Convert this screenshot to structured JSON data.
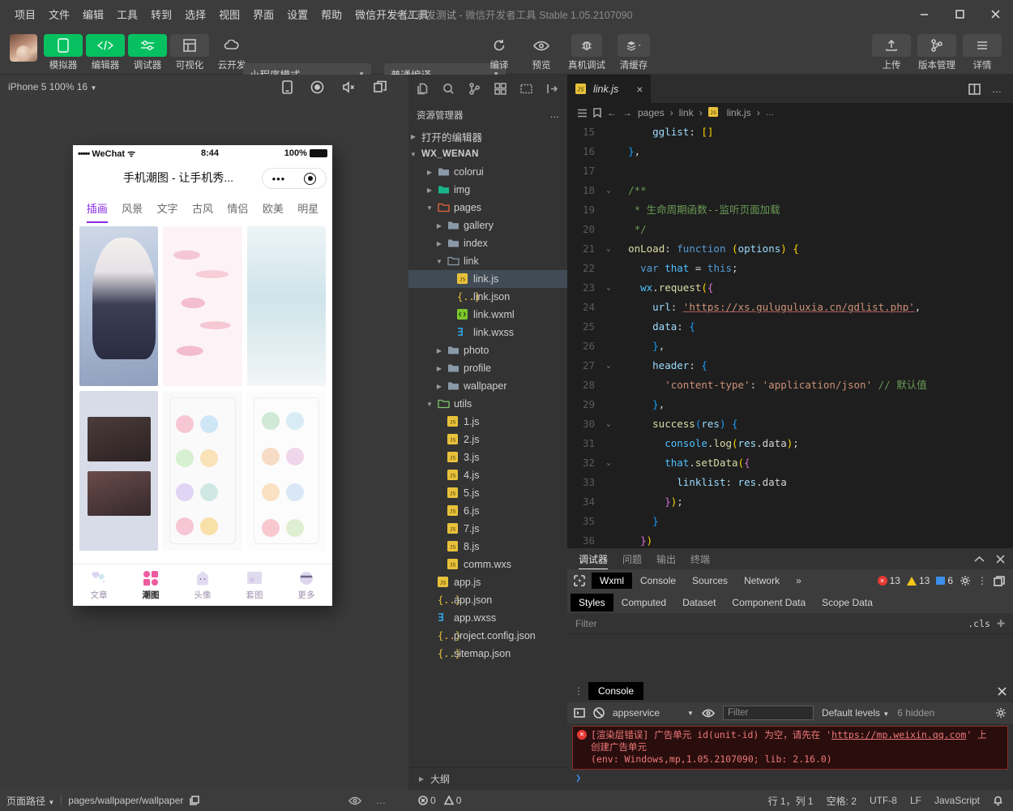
{
  "titlebar": {
    "menus": [
      "项目",
      "文件",
      "编辑",
      "工具",
      "转到",
      "选择",
      "视图",
      "界面",
      "设置",
      "帮助",
      "微信开发者工具"
    ],
    "project_name": "个人开发测试",
    "app_name": "微信开发者工具",
    "version": "Stable 1.05.2107090",
    "minimize": "minimize-icon",
    "maximize": "maximize-icon",
    "close": "close-icon"
  },
  "toolbar": {
    "left_buttons": [
      {
        "label": "模拟器",
        "icon": "phone-icon",
        "state": "green"
      },
      {
        "label": "编辑器",
        "icon": "code-icon",
        "state": "green"
      },
      {
        "label": "调试器",
        "icon": "debug-icon",
        "state": "green"
      },
      {
        "label": "可视化",
        "icon": "layout-icon",
        "state": "grey"
      },
      {
        "label": "云开发",
        "icon": "cloud-icon",
        "state": "plain"
      }
    ],
    "mode_select": "小程序模式",
    "compile_select": "普通编译",
    "center_buttons": [
      {
        "label": "编译",
        "icon": "refresh-icon"
      },
      {
        "label": "预览",
        "icon": "eye-icon"
      },
      {
        "label": "真机调试",
        "icon": "bug-icon"
      },
      {
        "label": "清缓存",
        "icon": "layers-icon"
      }
    ],
    "right_buttons": [
      {
        "label": "上传",
        "icon": "upload-icon"
      },
      {
        "label": "版本管理",
        "icon": "branch-icon"
      },
      {
        "label": "详情",
        "icon": "menu-icon"
      }
    ]
  },
  "simulator": {
    "device_label": "iPhone 5 100% 16",
    "toolbar_icons": [
      "device-rotate-icon",
      "record-icon",
      "mute-icon",
      "multiscreen-icon"
    ],
    "status_bar": {
      "carrier": "WeChat",
      "signal": "•••••",
      "time": "8:44",
      "battery": "100%"
    },
    "nav_title": "手机潮图 - 让手机秀...",
    "categories": [
      {
        "label": "插画",
        "active": true
      },
      {
        "label": "风景",
        "active": false
      },
      {
        "label": "文字",
        "active": false
      },
      {
        "label": "古风",
        "active": false
      },
      {
        "label": "情侣",
        "active": false
      },
      {
        "label": "欧美",
        "active": false
      },
      {
        "label": "明星",
        "active": false
      }
    ],
    "tabbar": [
      {
        "label": "文章",
        "icon": "hearts-icon",
        "active": false
      },
      {
        "label": "潮图",
        "icon": "grid-icon",
        "active": true
      },
      {
        "label": "头像",
        "icon": "ghost-icon",
        "active": false
      },
      {
        "label": "套图",
        "icon": "album-icon",
        "active": false
      },
      {
        "label": "更多",
        "icon": "more-face-icon",
        "active": false
      }
    ]
  },
  "explorer": {
    "activity_icons": [
      "files-icon",
      "search-icon",
      "source-control-icon",
      "extensions-icon",
      "cloud-fn-icon",
      "import-icon"
    ],
    "title": "资源管理器",
    "more": "…",
    "sections": [
      {
        "label": "打开的编辑器",
        "expanded": false,
        "indent": 0,
        "type": "section"
      },
      {
        "label": "WX_WENAN",
        "expanded": true,
        "indent": 0,
        "type": "root"
      }
    ],
    "tree": [
      {
        "label": "colorui",
        "type": "folder",
        "indent": 1,
        "expanded": false,
        "icon_color": "#8a99a8"
      },
      {
        "label": "img",
        "type": "folder",
        "indent": 1,
        "expanded": false,
        "icon_color": "#19b58a"
      },
      {
        "label": "pages",
        "type": "folder",
        "indent": 1,
        "expanded": true,
        "icon_color": "#e8663d"
      },
      {
        "label": "gallery",
        "type": "folder",
        "indent": 2,
        "expanded": false,
        "icon_color": "#8a99a8"
      },
      {
        "label": "index",
        "type": "folder",
        "indent": 2,
        "expanded": false,
        "icon_color": "#8a99a8"
      },
      {
        "label": "link",
        "type": "folder",
        "indent": 2,
        "expanded": true,
        "icon_color": "#8a99a8"
      },
      {
        "label": "link.js",
        "type": "js",
        "indent": 3,
        "selected": true
      },
      {
        "label": "link.json",
        "type": "json",
        "indent": 3
      },
      {
        "label": "link.wxml",
        "type": "wxml",
        "indent": 3
      },
      {
        "label": "link.wxss",
        "type": "wxss",
        "indent": 3
      },
      {
        "label": "photo",
        "type": "folder",
        "indent": 2,
        "expanded": false,
        "icon_color": "#8a99a8"
      },
      {
        "label": "profile",
        "type": "folder",
        "indent": 2,
        "expanded": false,
        "icon_color": "#8a99a8"
      },
      {
        "label": "wallpaper",
        "type": "folder",
        "indent": 2,
        "expanded": false,
        "icon_color": "#8a99a8"
      },
      {
        "label": "utils",
        "type": "folder",
        "indent": 1,
        "expanded": true,
        "icon_color": "#7ec46a"
      },
      {
        "label": "1.js",
        "type": "js",
        "indent": 2
      },
      {
        "label": "2.js",
        "type": "js",
        "indent": 2
      },
      {
        "label": "3.js",
        "type": "js",
        "indent": 2
      },
      {
        "label": "4.js",
        "type": "js",
        "indent": 2
      },
      {
        "label": "5.js",
        "type": "js",
        "indent": 2
      },
      {
        "label": "6.js",
        "type": "js",
        "indent": 2
      },
      {
        "label": "7.js",
        "type": "js",
        "indent": 2
      },
      {
        "label": "8.js",
        "type": "js",
        "indent": 2
      },
      {
        "label": "comm.wxs",
        "type": "js",
        "indent": 2
      },
      {
        "label": "app.js",
        "type": "js",
        "indent": 1
      },
      {
        "label": "app.json",
        "type": "json",
        "indent": 1
      },
      {
        "label": "app.wxss",
        "type": "wxss",
        "indent": 1
      },
      {
        "label": "project.config.json",
        "type": "json",
        "indent": 1
      },
      {
        "label": "sitemap.json",
        "type": "json",
        "indent": 1
      }
    ],
    "outline": "大纲"
  },
  "editor": {
    "tab_label": "link.js",
    "tab_close": "×",
    "breadcrumb": [
      "pages",
      "link",
      "link.js",
      "…"
    ],
    "right_icons": [
      "split-editor-icon",
      "more-actions-icon"
    ],
    "code_lines": [
      {
        "no": "",
        "fold": "",
        "html": "      <span class='k-key'>gglist</span><span class='ctext'>: </span><span class='k-br'>[]</span>"
      },
      {
        "no": "",
        "fold": "",
        "html": "  <span class='k-br3'>}</span><span class='ctext'>,</span>"
      },
      {
        "no": "",
        "fold": "",
        "html": ""
      },
      {
        "no": "",
        "fold": "⌄",
        "html": "  <span class='k-cm'>/**</span>"
      },
      {
        "no": "",
        "fold": "",
        "html": "   <span class='k-cm'>* 生命周期函数--监听页面加载</span>"
      },
      {
        "no": "",
        "fold": "",
        "html": "   <span class='k-cm'>*/</span>"
      },
      {
        "no": "",
        "fold": "⌄",
        "html": "  <span class='k-fn'>onLoad</span><span class='ctext'>: </span><span class='k-kw'>function</span> <span class='k-br'>(</span><span class='k-par'>options</span><span class='k-br'>)</span> <span class='k-br'>{</span>"
      },
      {
        "no": "",
        "fold": "",
        "html": "    <span class='k-kw'>var</span> <span class='k-var'>that</span> <span class='ctext'>= </span><span class='k-kw'>this</span><span class='ctext'>;</span>"
      },
      {
        "no": "",
        "fold": "⌄",
        "html": "    <span class='k-var'>wx</span><span class='ctext'>.</span><span class='k-fn'>request</span><span class='k-br'>(</span><span class='k-br2'>{</span>"
      },
      {
        "no": "",
        "fold": "",
        "html": "      <span class='k-key'>url</span><span class='ctext'>: </span><span class='k-url'>'https://xs.guluguluxia.cn/gdlist.php'</span><span class='ctext'>,</span>"
      },
      {
        "no": "",
        "fold": "",
        "html": "      <span class='k-key'>data</span><span class='ctext'>: </span><span class='k-br3'>{</span>"
      },
      {
        "no": "",
        "fold": "",
        "html": "      <span class='k-br3'>}</span><span class='ctext'>,</span>"
      },
      {
        "no": "",
        "fold": "⌄",
        "html": "      <span class='k-key'>header</span><span class='ctext'>: </span><span class='k-br3'>{</span>"
      },
      {
        "no": "",
        "fold": "",
        "html": "        <span class='k-str'>'content-type'</span><span class='ctext'>: </span><span class='k-str'>'application/json'</span> <span class='k-cm'>// 默认值</span>"
      },
      {
        "no": "",
        "fold": "",
        "html": "      <span class='k-br3'>}</span><span class='ctext'>,</span>"
      },
      {
        "no": "",
        "fold": "⌄",
        "html": "      <span class='k-fn'>success</span><span class='k-br3'>(</span><span class='k-par'>res</span><span class='k-br3'>)</span> <span class='k-br3'>{</span>"
      },
      {
        "no": "",
        "fold": "",
        "html": "        <span class='k-var'>console</span><span class='ctext'>.</span><span class='k-fn'>log</span><span class='k-br'>(</span><span class='k-par'>res</span><span class='ctext'>.data</span><span class='k-br'>)</span><span class='ctext'>;</span>"
      },
      {
        "no": "",
        "fold": "⌄",
        "html": "        <span class='k-var'>that</span><span class='ctext'>.</span><span class='k-fn'>setData</span><span class='k-br'>(</span><span class='k-br2'>{</span>"
      },
      {
        "no": "",
        "fold": "",
        "html": "          <span class='k-key'>linklist</span><span class='ctext'>: </span><span class='k-par'>res</span><span class='ctext'>.data</span>"
      },
      {
        "no": "",
        "fold": "",
        "html": "        <span class='k-br2'>}</span><span class='k-br'>)</span><span class='ctext'>;</span>"
      },
      {
        "no": "",
        "fold": "",
        "html": "      <span class='k-br3'>}</span>"
      },
      {
        "no": "",
        "fold": "",
        "html": "    <span class='k-br2'>}</span><span class='k-br'>)</span>"
      }
    ]
  },
  "debugger": {
    "panel_tabs": [
      {
        "label": "调试器",
        "active": true
      },
      {
        "label": "问题",
        "active": false
      },
      {
        "label": "输出",
        "active": false
      },
      {
        "label": "终端",
        "active": false
      }
    ],
    "panel_actions": [
      "collapse-icon",
      "close-icon"
    ],
    "devtools_tabs": [
      {
        "label": "Wxml",
        "active": true
      },
      {
        "label": "Console",
        "active": false
      },
      {
        "label": "Sources",
        "active": false
      },
      {
        "label": "Network",
        "active": false
      },
      {
        "label": "»",
        "active": false
      }
    ],
    "inspect_icon": "inspect-element-icon",
    "counts": {
      "errors": "13",
      "warnings": "13",
      "info": "6"
    },
    "right_icons": [
      "settings-gear-icon",
      "kebab-menu-icon",
      "dock-icon"
    ],
    "style_tabs": [
      {
        "label": "Styles",
        "active": true
      },
      {
        "label": "Computed",
        "active": false
      },
      {
        "label": "Dataset",
        "active": false
      },
      {
        "label": "Component Data",
        "active": false
      },
      {
        "label": "Scope Data",
        "active": false
      }
    ],
    "filter_placeholder": "Filter",
    "cls_label": ".cls",
    "plus_icon": "add-rule-icon"
  },
  "console": {
    "tab_label": "Console",
    "drag_icon": "drag-handle-icon",
    "close_icon": "close-icon",
    "toolbar": {
      "sidebar_icon": "console-sidebar-icon",
      "clear_icon": "clear-console-icon",
      "context": "appservice",
      "eye_icon": "live-expression-icon",
      "filter_placeholder": "Filter",
      "levels": "Default levels",
      "hidden": "6 hidden",
      "settings_icon": "settings-gear-icon"
    },
    "error": {
      "line1": "[渲染层错误] 广告单元 id(unit-id) 为空，请先在 ",
      "link": "https://mp.weixin.qq.com",
      "line1_end": "' 上",
      "line2": "创建广告单元",
      "line3": "(env: Windows,mp,1.05.2107090; lib: 2.16.0)"
    },
    "prompt": "❯"
  },
  "statusbar": {
    "page_path_label": "页面路径",
    "page_path": "pages/wallpaper/wallpaper",
    "copy_icon": "copy-icon",
    "eye_icon": "eye-icon",
    "more_icon": "more-icon",
    "errors": "0",
    "warnings": "0",
    "cursor": "行 1，列 1",
    "spaces": "空格: 2",
    "encoding": "UTF-8",
    "eol": "LF",
    "language": "JavaScript",
    "bell_icon": "bell-icon"
  },
  "colors": {
    "accent_green": "#07c160",
    "titlebar_bg": "#3c3c3c",
    "editor_bg": "#1e1e1e",
    "error_red": "#e53935",
    "category_active": "#8a2be2"
  }
}
